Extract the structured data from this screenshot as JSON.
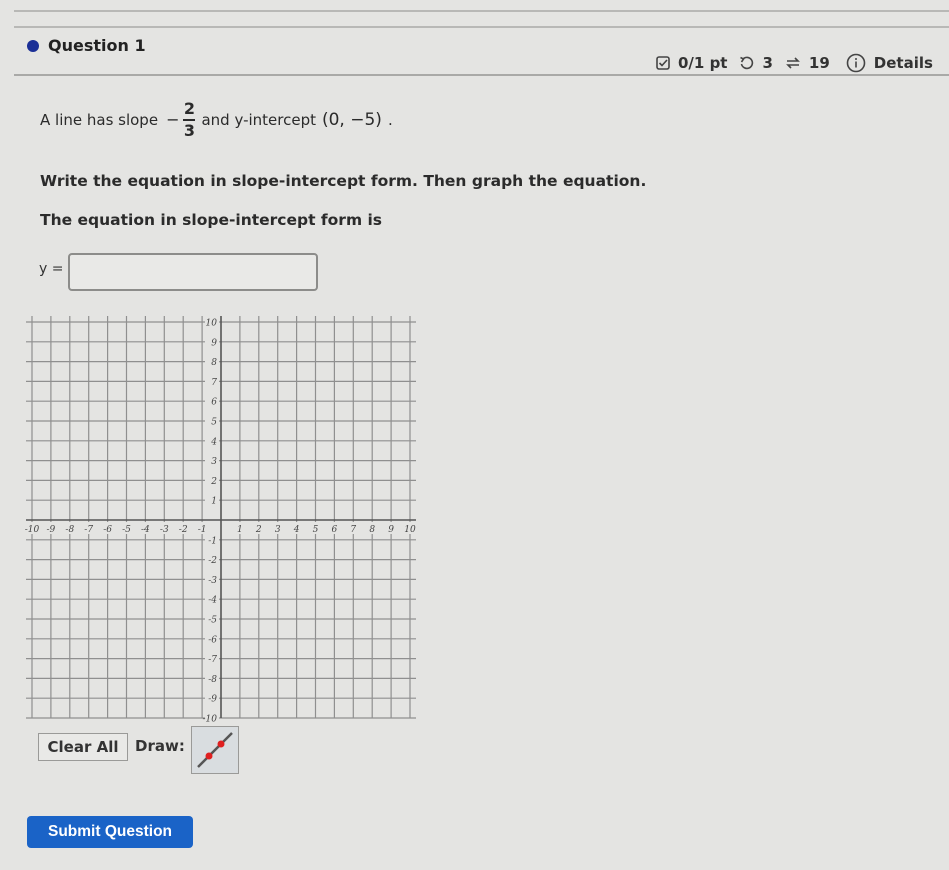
{
  "question": {
    "title": "Question 1",
    "score": "0/1 pt",
    "retries": "3",
    "attempts": "19",
    "details_label": "Details",
    "icons": {
      "status": "circle-filled-icon",
      "score": "checkbox-icon",
      "retries": "undo-icon",
      "attempts": "repeat-icon",
      "details": "info-icon"
    }
  },
  "prompt": {
    "line1_prefix": "A line has slope",
    "slope_sign": "−",
    "slope_numerator": "2",
    "slope_denominator": "3",
    "line1_middle": "and y-intercept",
    "intercept": "(0, −5)",
    "line1_suffix": ".",
    "line2": "Write the equation in slope-intercept form. Then graph the equation.",
    "line3": "The equation in slope-intercept form is"
  },
  "answer": {
    "label": "y =",
    "value": "",
    "placeholder": ""
  },
  "graph": {
    "x_min": -10,
    "x_max": 10,
    "y_min": -10,
    "y_max": 10,
    "x_ticks": [
      "-10",
      "-9",
      "-8",
      "-7",
      "-6",
      "-5",
      "-4",
      "-3",
      "-2",
      "-1",
      "1",
      "2",
      "3",
      "4",
      "5",
      "6",
      "7",
      "8",
      "9",
      "10"
    ],
    "y_ticks": [
      "10",
      "9",
      "8",
      "7",
      "6",
      "5",
      "4",
      "3",
      "2",
      "1",
      "-1",
      "-2",
      "-3",
      "-4",
      "-5",
      "-6",
      "-7",
      "-8",
      "-9",
      "-10"
    ],
    "grid": true
  },
  "tools": {
    "clear_label": "Clear All",
    "draw_label": "Draw:",
    "draw_tool_icon": "line-tool-icon",
    "accent_point_color": "#e02020"
  },
  "submit": {
    "label": "Submit Question",
    "color": "#1a63c7"
  }
}
